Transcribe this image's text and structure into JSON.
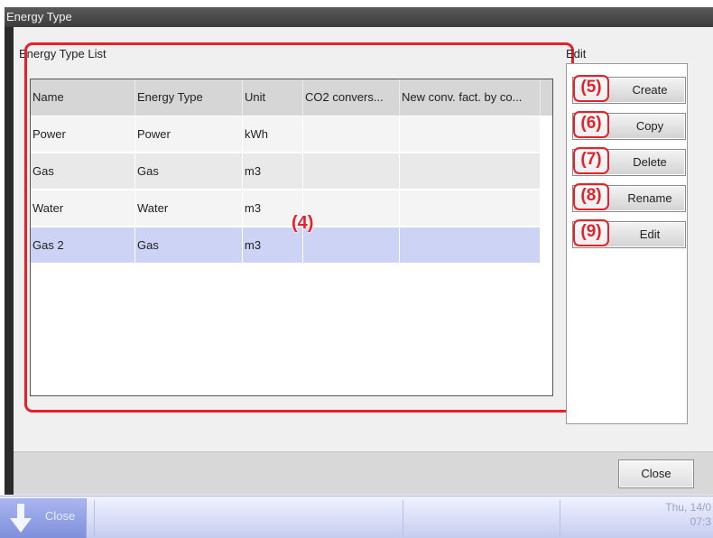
{
  "window": {
    "title": "Energy Type"
  },
  "list": {
    "title": "Energy Type List",
    "columns": [
      "Name",
      "Energy Type",
      "Unit",
      "CO2 convers...",
      "New conv. fact. by co..."
    ],
    "rows": [
      [
        "Power",
        "Power",
        "kWh",
        "",
        ""
      ],
      [
        "Gas",
        "Gas",
        "m3",
        "",
        ""
      ],
      [
        "Water",
        "Water",
        "m3",
        "",
        ""
      ],
      [
        "Gas 2",
        "Gas",
        "m3",
        "",
        ""
      ]
    ],
    "selected_row": 3,
    "callout": "(4)"
  },
  "edit": {
    "label": "Edit",
    "buttons": [
      {
        "label": "Create",
        "callout": "(5)"
      },
      {
        "label": "Copy",
        "callout": "(6)"
      },
      {
        "label": "Delete",
        "callout": "(7)"
      },
      {
        "label": "Rename",
        "callout": "(8)"
      },
      {
        "label": "Edit",
        "callout": "(9)"
      }
    ]
  },
  "footer": {
    "close_label": "Close"
  },
  "taskbar": {
    "close_label": "Close",
    "date": "Thu, 14/0",
    "time": "07:3"
  },
  "colors": {
    "annotation": "#e8202a",
    "selected_row": "#cdd3f4",
    "taskbar": "#c6ccf0"
  }
}
